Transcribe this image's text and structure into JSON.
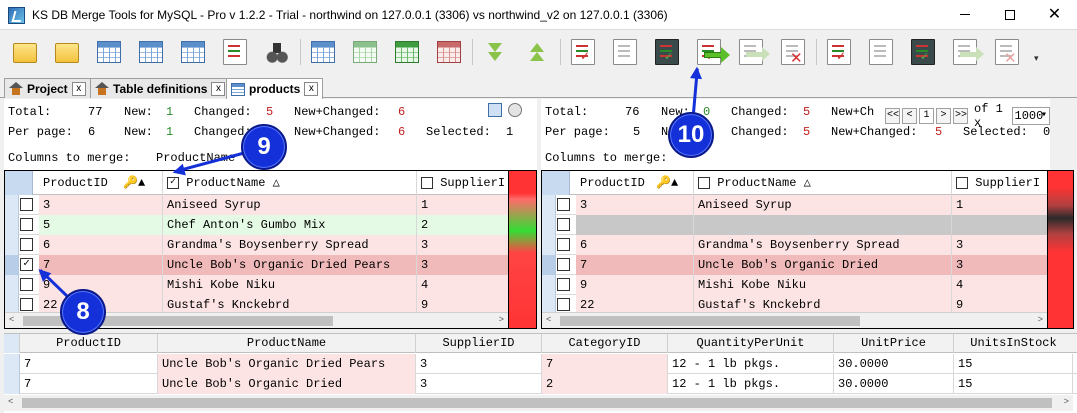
{
  "window": {
    "title": "KS DB Merge Tools for MySQL - Pro v 1.2.2 - Trial - northwind on 127.0.0.1 (3306) vs northwind_v2 on 127.0.0.1 (3306)",
    "minimize": "–",
    "maximize": "□",
    "close": "✕"
  },
  "toolbar": {
    "more": "▾"
  },
  "tabs": [
    {
      "label": "Project",
      "close": "x"
    },
    {
      "label": "Table definitions",
      "close": "x"
    },
    {
      "label": "products",
      "close": "x"
    }
  ],
  "left": {
    "stats": {
      "total_label": "Total:",
      "total": "77",
      "new_label": "New:",
      "new": "1",
      "changed_label": "Changed:",
      "changed": "5",
      "newchanged_label": "New+Changed:",
      "newchanged": "6",
      "perpage_label": "Per page:",
      "perpage": "6",
      "pp_new_label": "New:",
      "pp_new": "1",
      "pp_changed_label": "Changed:",
      "pp_changed": "5",
      "pp_newchanged_label": "New+Changed:",
      "pp_newchanged": "6",
      "selected_label": "Selected:",
      "selected": "1",
      "columns_label": "Columns to merge:",
      "columns": "ProductName"
    },
    "columns": [
      "ProductID",
      "ProductName",
      "SupplierI"
    ],
    "rows": [
      {
        "id": "3",
        "name": "Aniseed Syrup",
        "supplier": "1",
        "checked": "",
        "style": "pink"
      },
      {
        "id": "5",
        "name": "Chef Anton's Gumbo Mix",
        "supplier": "2",
        "checked": "",
        "style": "green"
      },
      {
        "id": "6",
        "name": "Grandma's Boysenberry Spread",
        "supplier": "3",
        "checked": "",
        "style": "pink"
      },
      {
        "id": "7",
        "name": "Uncle Bob's Organic Dried Pears",
        "supplier": "3",
        "checked": "✓",
        "style": "pink"
      },
      {
        "id": "9",
        "name": "Mishi Kobe Niku",
        "supplier": "4",
        "checked": "",
        "style": "pink"
      },
      {
        "id": "22",
        "name": "Gustaf's Knckebrd",
        "supplier": "9",
        "checked": "",
        "style": "pink"
      }
    ]
  },
  "right": {
    "stats": {
      "total_label": "Total:",
      "total": "76",
      "new_label": "New:",
      "new": "0",
      "changed_label": "Changed:",
      "changed": "5",
      "newchanged_label": "New+Ch",
      "perpage_label": "Per page:",
      "perpage": "5",
      "pp_new_label": "N",
      "pp_changed_label": "Changed:",
      "pp_changed": "5",
      "pp_newchanged_label": "New+Changed:",
      "pp_newchanged": "5",
      "selected_label": "Selected:",
      "selected": "0",
      "columns_label": "Columns to merge:",
      "pager_first": "<<",
      "pager_prev": "<",
      "pager_page": "1",
      "pager_next": ">",
      "pager_last": ">>",
      "pager_of": "of 1 x",
      "pager_size": "1000"
    },
    "columns": [
      "ProductID",
      "ProductName",
      "SupplierI"
    ],
    "rows": [
      {
        "id": "3",
        "name": "Aniseed Syrup",
        "supplier": "1",
        "style": "pink"
      },
      {
        "id": "",
        "name": "",
        "supplier": "",
        "style": "grey"
      },
      {
        "id": "6",
        "name": "Grandma's Boysenberry Spread",
        "supplier": "3",
        "style": "pink"
      },
      {
        "id": "7",
        "name": "Uncle Bob's Organic Dried",
        "supplier": "3",
        "style": "pink"
      },
      {
        "id": "9",
        "name": "Mishi Kobe Niku",
        "supplier": "4",
        "style": "pink"
      },
      {
        "id": "22",
        "name": "Gustaf's Knckebrd",
        "supplier": "9",
        "style": "pink"
      }
    ]
  },
  "bottom": {
    "columns": [
      "ProductID",
      "ProductName",
      "SupplierID",
      "CategoryID",
      "QuantityPerUnit",
      "UnitPrice",
      "UnitsInStock"
    ],
    "rows": [
      [
        "7",
        "Uncle Bob's Organic Dried Pears",
        "3",
        "7",
        "12 - 1 lb pkgs.",
        "30.0000",
        "15"
      ],
      [
        "7",
        "Uncle Bob's Organic Dried",
        "3",
        "2",
        "12 - 1 lb pkgs.",
        "30.0000",
        "15"
      ]
    ]
  },
  "callouts": {
    "c8": "8",
    "c9": "9",
    "c10": "10"
  },
  "scroll": {
    "left": "<",
    "right": ">"
  }
}
